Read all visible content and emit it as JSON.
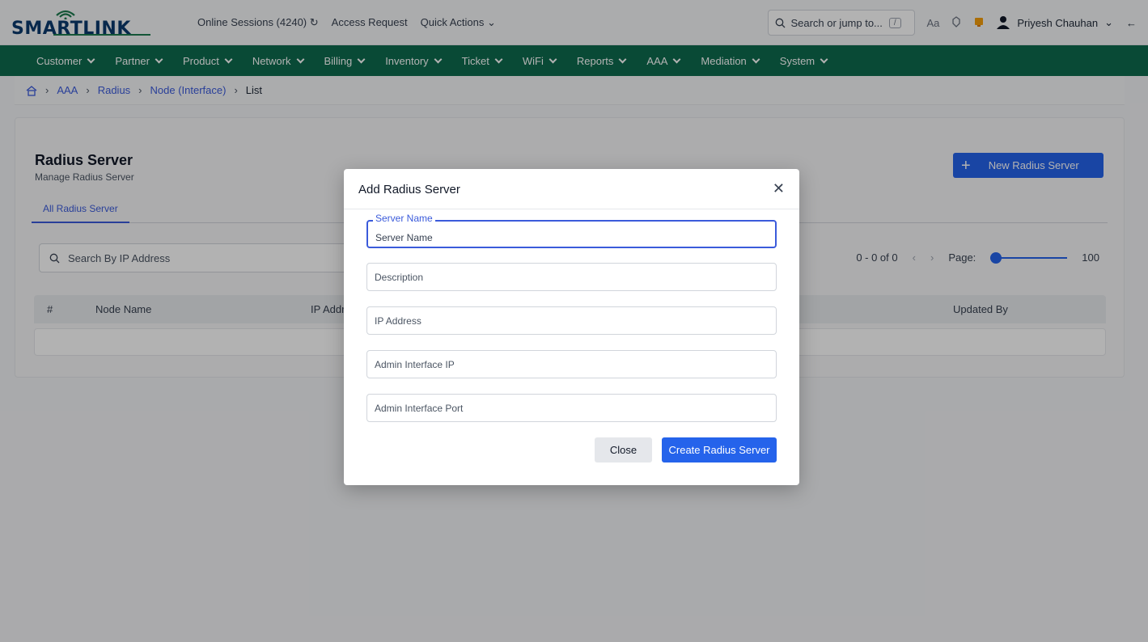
{
  "brand": {
    "name": "SMARTLINK",
    "accent_color": "#0d6b4e",
    "primary_color": "#2563eb"
  },
  "header": {
    "online_sessions": "Online Sessions (4240)",
    "refresh_icon": "refresh-icon",
    "access_request": "Access Request",
    "quick_actions": "Quick Actions",
    "search_placeholder": "Search or jump to...",
    "search_shortcut": "/",
    "font_size_toggle": "Aa",
    "user_name": "Priyesh Chauhan"
  },
  "nav": {
    "items": [
      {
        "label": "Customer"
      },
      {
        "label": "Partner"
      },
      {
        "label": "Product"
      },
      {
        "label": "Network"
      },
      {
        "label": "Billing"
      },
      {
        "label": "Inventory"
      },
      {
        "label": "Ticket"
      },
      {
        "label": "WiFi"
      },
      {
        "label": "Reports"
      },
      {
        "label": "AAA"
      },
      {
        "label": "Mediation"
      },
      {
        "label": "System"
      }
    ]
  },
  "breadcrumb": {
    "items": [
      "AAA",
      "Radius",
      "Node (Interface)"
    ],
    "current": "List"
  },
  "page": {
    "title": "Radius Server",
    "subtitle": "Manage Radius Server",
    "new_button": "New Radius Server",
    "tab": "All Radius Server",
    "search_placeholder": "Search By IP Address",
    "pagination": {
      "range": "0 - 0 of 0",
      "page_label": "Page:",
      "page_size": "100"
    },
    "columns": [
      "#",
      "Node Name",
      "IP Addr",
      "Updated By"
    ]
  },
  "modal": {
    "title": "Add Radius Server",
    "fields": [
      {
        "label": "Server Name",
        "value": "Server Name"
      },
      {
        "placeholder": "Description"
      },
      {
        "placeholder": "IP Address"
      },
      {
        "placeholder": "Admin Interface IP"
      },
      {
        "placeholder": "Admin Interface Port"
      }
    ],
    "close_button": "Close",
    "create_button": "Create Radius Server"
  }
}
